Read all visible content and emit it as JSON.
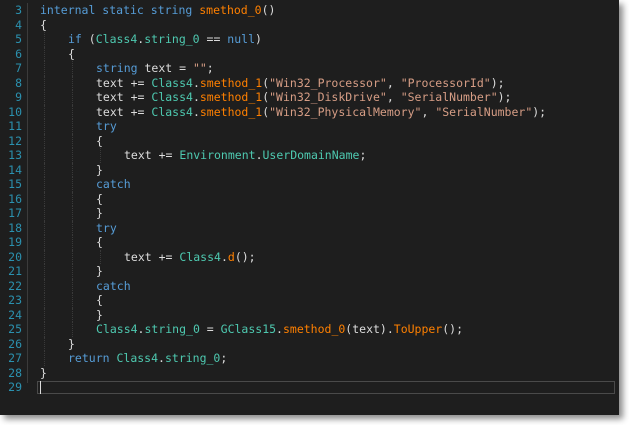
{
  "editor": {
    "lines": [
      {
        "n": "3",
        "indent": 0,
        "tokens": [
          [
            "kw",
            "internal static string "
          ],
          [
            "mt",
            "smethod_0"
          ],
          [
            "pl",
            "()"
          ]
        ]
      },
      {
        "n": "4",
        "indent": 0,
        "tokens": [
          [
            "pl",
            "{"
          ]
        ]
      },
      {
        "n": "5",
        "indent": 1,
        "tokens": [
          [
            "kw",
            "if"
          ],
          [
            "pl",
            " ("
          ],
          [
            "ty",
            "Class4"
          ],
          [
            "pl",
            "."
          ],
          [
            "ty",
            "string_0"
          ],
          [
            "pl",
            " == "
          ],
          [
            "kw",
            "null"
          ],
          [
            "pl",
            ")"
          ]
        ]
      },
      {
        "n": "6",
        "indent": 1,
        "tokens": [
          [
            "pl",
            "{"
          ]
        ]
      },
      {
        "n": "7",
        "indent": 2,
        "tokens": [
          [
            "kw",
            "string"
          ],
          [
            "pl",
            " text = "
          ],
          [
            "st",
            "\"\""
          ],
          [
            "pl",
            ";"
          ]
        ]
      },
      {
        "n": "8",
        "indent": 2,
        "tokens": [
          [
            "pl",
            "text += "
          ],
          [
            "ty",
            "Class4"
          ],
          [
            "pl",
            "."
          ],
          [
            "mt",
            "smethod_1"
          ],
          [
            "pl",
            "("
          ],
          [
            "st",
            "\"Win32_Processor\""
          ],
          [
            "pl",
            ", "
          ],
          [
            "st",
            "\"ProcessorId\""
          ],
          [
            "pl",
            ");"
          ]
        ]
      },
      {
        "n": "9",
        "indent": 2,
        "tokens": [
          [
            "pl",
            "text += "
          ],
          [
            "ty",
            "Class4"
          ],
          [
            "pl",
            "."
          ],
          [
            "mt",
            "smethod_1"
          ],
          [
            "pl",
            "("
          ],
          [
            "st",
            "\"Win32_DiskDrive\""
          ],
          [
            "pl",
            ", "
          ],
          [
            "st",
            "\"SerialNumber\""
          ],
          [
            "pl",
            ");"
          ]
        ]
      },
      {
        "n": "10",
        "indent": 2,
        "tokens": [
          [
            "pl",
            "text += "
          ],
          [
            "ty",
            "Class4"
          ],
          [
            "pl",
            "."
          ],
          [
            "mt",
            "smethod_1"
          ],
          [
            "pl",
            "("
          ],
          [
            "st",
            "\"Win32_PhysicalMemory\""
          ],
          [
            "pl",
            ", "
          ],
          [
            "st",
            "\"SerialNumber\""
          ],
          [
            "pl",
            ");"
          ]
        ]
      },
      {
        "n": "11",
        "indent": 2,
        "tokens": [
          [
            "kw",
            "try"
          ]
        ]
      },
      {
        "n": "12",
        "indent": 2,
        "tokens": [
          [
            "pl",
            "{"
          ]
        ]
      },
      {
        "n": "13",
        "indent": 3,
        "tokens": [
          [
            "pl",
            "text += "
          ],
          [
            "ty",
            "Environment"
          ],
          [
            "pl",
            "."
          ],
          [
            "ty",
            "UserDomainName"
          ],
          [
            "pl",
            ";"
          ]
        ]
      },
      {
        "n": "14",
        "indent": 2,
        "tokens": [
          [
            "pl",
            "}"
          ]
        ]
      },
      {
        "n": "15",
        "indent": 2,
        "tokens": [
          [
            "kw",
            "catch"
          ]
        ]
      },
      {
        "n": "16",
        "indent": 2,
        "tokens": [
          [
            "pl",
            "{"
          ]
        ]
      },
      {
        "n": "17",
        "indent": 2,
        "tokens": [
          [
            "pl",
            "}"
          ]
        ]
      },
      {
        "n": "18",
        "indent": 2,
        "tokens": [
          [
            "kw",
            "try"
          ]
        ]
      },
      {
        "n": "19",
        "indent": 2,
        "tokens": [
          [
            "pl",
            "{"
          ]
        ]
      },
      {
        "n": "20",
        "indent": 3,
        "tokens": [
          [
            "pl",
            "text += "
          ],
          [
            "ty",
            "Class4"
          ],
          [
            "pl",
            "."
          ],
          [
            "mt",
            "d"
          ],
          [
            "pl",
            "();"
          ]
        ]
      },
      {
        "n": "21",
        "indent": 2,
        "tokens": [
          [
            "pl",
            "}"
          ]
        ]
      },
      {
        "n": "22",
        "indent": 2,
        "tokens": [
          [
            "kw",
            "catch"
          ]
        ]
      },
      {
        "n": "23",
        "indent": 2,
        "tokens": [
          [
            "pl",
            "{"
          ]
        ]
      },
      {
        "n": "24",
        "indent": 2,
        "tokens": [
          [
            "pl",
            "}"
          ]
        ]
      },
      {
        "n": "25",
        "indent": 2,
        "tokens": [
          [
            "ty",
            "Class4"
          ],
          [
            "pl",
            "."
          ],
          [
            "ty",
            "string_0"
          ],
          [
            "pl",
            " = "
          ],
          [
            "ty",
            "GClass15"
          ],
          [
            "pl",
            "."
          ],
          [
            "mt",
            "smethod_0"
          ],
          [
            "pl",
            "(text)."
          ],
          [
            "mt",
            "ToUpper"
          ],
          [
            "pl",
            "();"
          ]
        ]
      },
      {
        "n": "26",
        "indent": 1,
        "tokens": [
          [
            "pl",
            "}"
          ]
        ]
      },
      {
        "n": "27",
        "indent": 1,
        "tokens": [
          [
            "kw",
            "return"
          ],
          [
            "pl",
            " "
          ],
          [
            "ty",
            "Class4"
          ],
          [
            "pl",
            "."
          ],
          [
            "ty",
            "string_0"
          ],
          [
            "pl",
            ";"
          ]
        ]
      },
      {
        "n": "28",
        "indent": 0,
        "tokens": [
          [
            "pl",
            "}"
          ]
        ]
      },
      {
        "n": "29",
        "indent": 0,
        "tokens": []
      }
    ],
    "current_line": "29"
  },
  "colors": {
    "background": "#1e1e1e",
    "line_number": "#2b91af",
    "keyword": "#569cd6",
    "type": "#4ec9b0",
    "method": "#ff8000",
    "string": "#d69d85",
    "plain": "#dcdcdc"
  }
}
